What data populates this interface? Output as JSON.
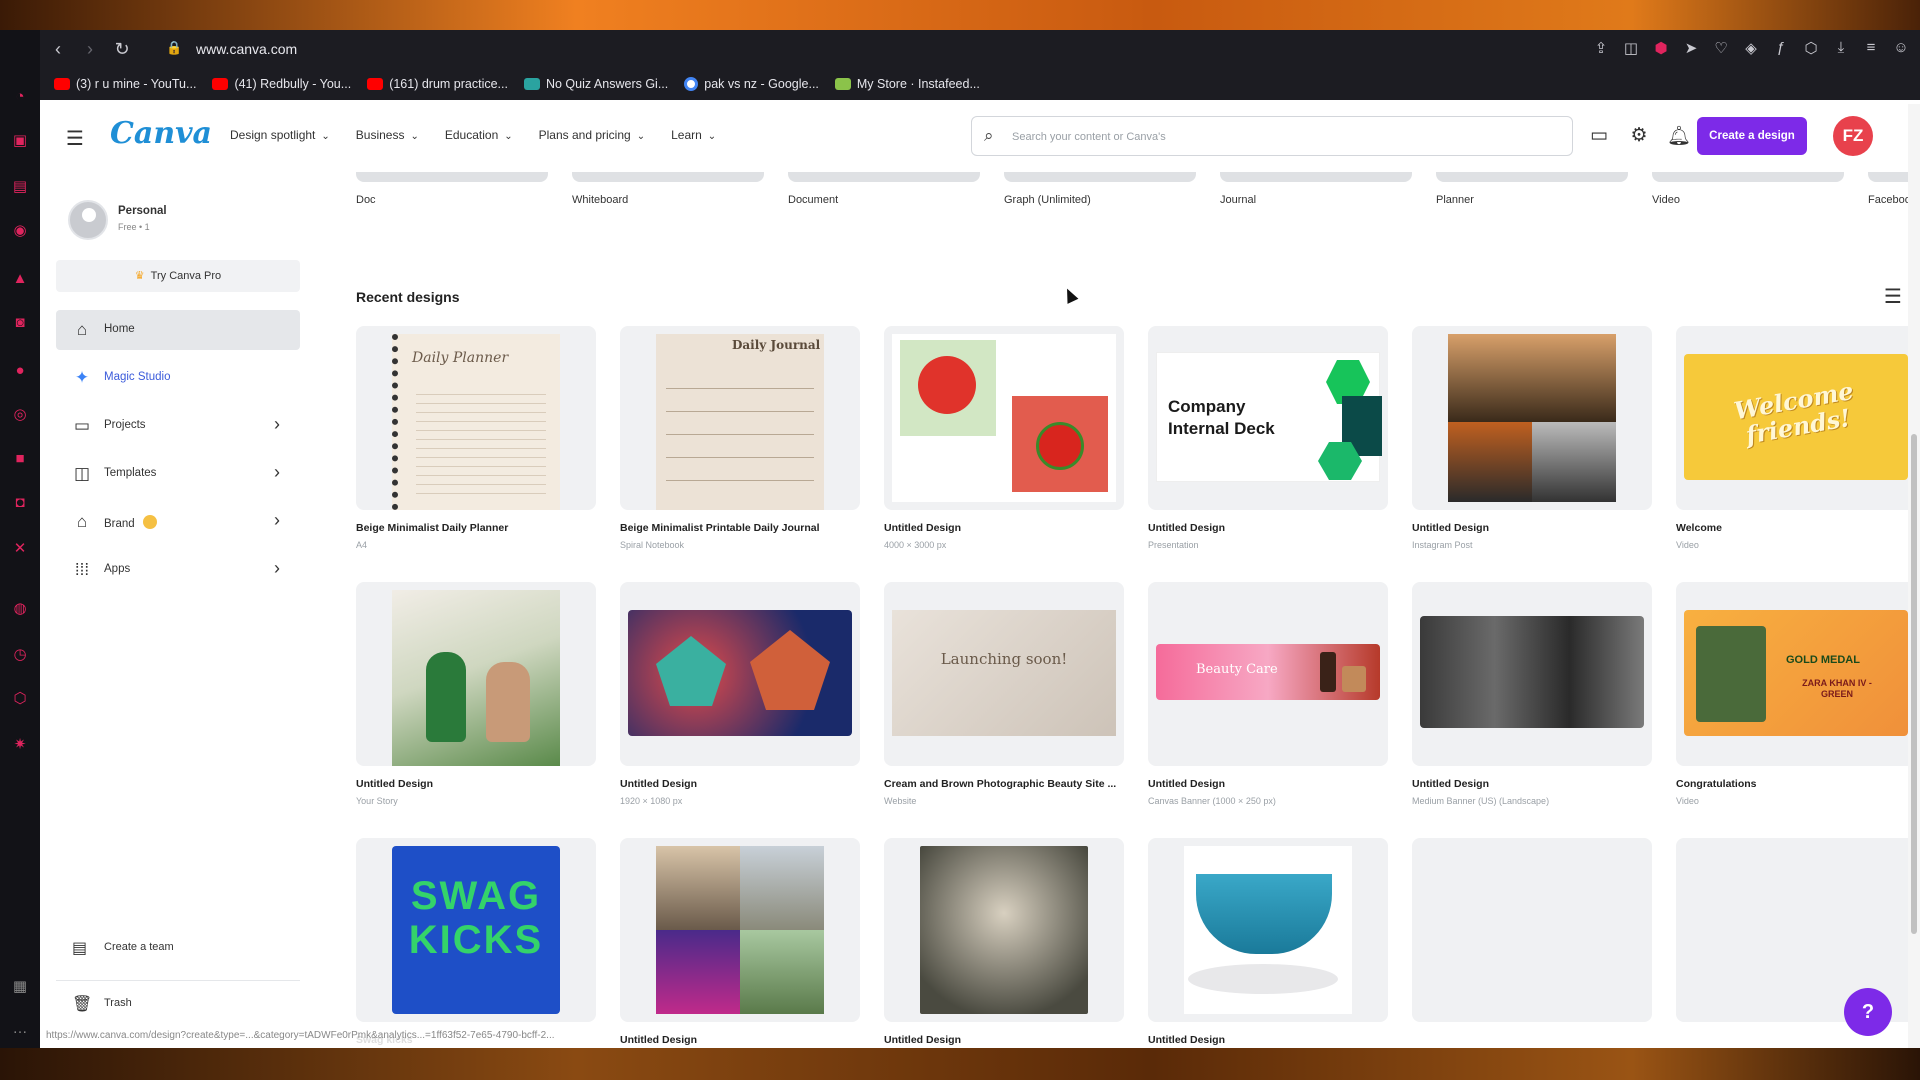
{
  "browser": {
    "url": "www.canva.com",
    "bookmarks": [
      {
        "label": "(3) r u mine - YouTu...",
        "type": "yt"
      },
      {
        "label": "(41) Redbully - You...",
        "type": "yt"
      },
      {
        "label": "(161) drum practice...",
        "type": "yt"
      },
      {
        "label": "No Quiz Answers Gi...",
        "type": "q"
      },
      {
        "label": "pak vs nz - Google...",
        "type": "g"
      },
      {
        "label": "My Store · Instafeed...",
        "type": "s"
      }
    ]
  },
  "topbar": {
    "logo": "Canva",
    "nav": [
      "Design spotlight",
      "Business",
      "Education",
      "Plans and pricing",
      "Learn"
    ],
    "search_placeholder": "Search your content or Canva's",
    "create_label": "Create a design",
    "avatar_initials": "FZ"
  },
  "sidebar": {
    "profile_name": "Personal",
    "profile_sub": "Free • 1",
    "try_pro": "Try Canva Pro",
    "items": [
      {
        "label": "Home",
        "icon": "home-icon"
      },
      {
        "label": "Magic Studio",
        "icon": "sparkle-icon"
      },
      {
        "label": "Projects",
        "icon": "folder-icon"
      },
      {
        "label": "Templates",
        "icon": "templates-icon"
      },
      {
        "label": "Brand",
        "icon": "brand-icon"
      },
      {
        "label": "Apps",
        "icon": "apps-icon"
      }
    ],
    "create_team": "Create a team",
    "trash": "Trash"
  },
  "types": [
    "Doc",
    "Whiteboard",
    "Document",
    "Graph (Unlimited)",
    "Journal",
    "Planner",
    "Video",
    "Faceboo"
  ],
  "recent_title": "Recent designs",
  "designs": [
    {
      "title": "Beige Minimalist Daily Planner",
      "meta": "A4"
    },
    {
      "title": "Beige Minimalist Printable Daily Journal",
      "meta": "Spiral Notebook"
    },
    {
      "title": "Untitled Design",
      "meta": "4000 × 3000 px"
    },
    {
      "title": "Untitled Design",
      "meta": "Presentation"
    },
    {
      "title": "Untitled Design",
      "meta": "Instagram Post"
    },
    {
      "title": "Welcome",
      "meta": "Video"
    },
    {
      "title": "Untitled Design",
      "meta": "Your Story"
    },
    {
      "title": "Untitled Design",
      "meta": "1920 × 1080 px"
    },
    {
      "title": "Cream and Brown Photographic Beauty Site ...",
      "meta": "Website"
    },
    {
      "title": "Untitled Design",
      "meta": "Canvas Banner (1000 × 250 px)"
    },
    {
      "title": "Untitled Design",
      "meta": "Medium Banner (US) (Landscape)"
    },
    {
      "title": "Congratulations",
      "meta": "Video"
    },
    {
      "title": "Swag kicks",
      "meta": ""
    },
    {
      "title": "Untitled Design",
      "meta": ""
    },
    {
      "title": "Untitled Design",
      "meta": ""
    },
    {
      "title": "Untitled Design",
      "meta": ""
    },
    {
      "title": "",
      "meta": ""
    },
    {
      "title": "",
      "meta": ""
    }
  ],
  "thumb_text": {
    "daily_planner": "Daily Planner",
    "daily_journal": "Daily Journal",
    "company_deck": "Company Internal Deck",
    "welcome": "Welcome friends!",
    "launching": "Launching soon!",
    "beauty_care": "Beauty Care",
    "gold_medal": "GOLD MEDAL",
    "zara": "ZARA KHAN IV - GREEN",
    "swag": "SWAG KICKS"
  },
  "status_url": "https://www.canva.com/design?create&type=...&category=tADWFe0rPmk&analytics...=1ff63f52-7e65-4790-bcff-2...",
  "help_label": "?",
  "colors": {
    "brand": "#7d2ae8",
    "avatar": "#e8414c"
  }
}
